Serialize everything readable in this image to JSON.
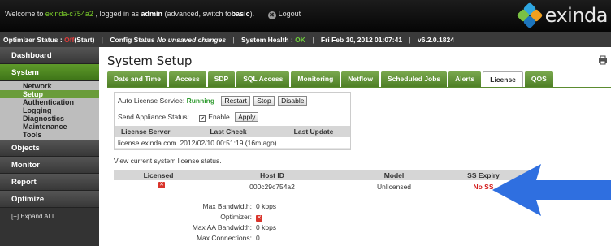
{
  "header": {
    "welcome_prefix": "Welcome to",
    "hostname": "exinda-c754a2",
    "logged_in_as": ", logged in as",
    "user": "admin",
    "mode_text": "(advanced, switch to",
    "switch_link": "basic",
    "mode_end": ").",
    "logout": "Logout",
    "logo_text": "exinda"
  },
  "statusbar": {
    "optimizer_label": "Optimizer Status :",
    "optimizer_value": "Off",
    "optimizer_start": "(Start)",
    "config_label": "Config Status",
    "config_value": "No unsaved changes",
    "health_label": "System Health :",
    "health_value": "OK",
    "datetime": "Fri Feb 10, 2012 01:07:41",
    "version": "v6.2.0.1824"
  },
  "sidebar": {
    "dashboard": "Dashboard",
    "system": "System",
    "system_items": [
      "Network",
      "Setup",
      "Authentication",
      "Logging",
      "Diagnostics",
      "Maintenance",
      "Tools"
    ],
    "objects": "Objects",
    "monitor": "Monitor",
    "report": "Report",
    "optimize": "Optimize",
    "expand_all": "[+] Expand ALL"
  },
  "main": {
    "title": "System Setup",
    "tabs": [
      "Date and Time",
      "Access",
      "SDP",
      "SQL Access",
      "Monitoring",
      "Netflow",
      "Scheduled Jobs",
      "Alerts",
      "License",
      "QOS"
    ],
    "active_tab": "License"
  },
  "license_service": {
    "label": "Auto License Service:",
    "status": "Running",
    "restart": "Restart",
    "stop": "Stop",
    "disable": "Disable",
    "send_status_label": "Send Appliance Status:",
    "enable_label": "Enable",
    "enable_checked": "✔",
    "apply": "Apply",
    "columns": [
      "License Server",
      "Last Check",
      "Last Update"
    ],
    "row": {
      "server": "license.exinda.com",
      "last_check": "2012/02/10 00:51:19 (16m ago)",
      "last_update": ""
    }
  },
  "system_license": {
    "intro": "View current system license status.",
    "columns": [
      "Licensed",
      "Host ID",
      "Model",
      "SS Expiry"
    ],
    "row": {
      "host_id": "000c29c754a2",
      "model": "Unlicensed",
      "ss_expiry": "No SS"
    },
    "details": [
      {
        "label": "Max Bandwidth:",
        "value": "0 kbps"
      },
      {
        "label": "Optimizer:",
        "value": ""
      },
      {
        "label": "Max AA Bandwidth:",
        "value": "0 kbps"
      },
      {
        "label": "Max Connections:",
        "value": "0"
      }
    ]
  },
  "colors": {
    "accent_green": "#5b8c30",
    "arrow_blue": "#2f6fe0",
    "error_red": "#d41c1c"
  }
}
